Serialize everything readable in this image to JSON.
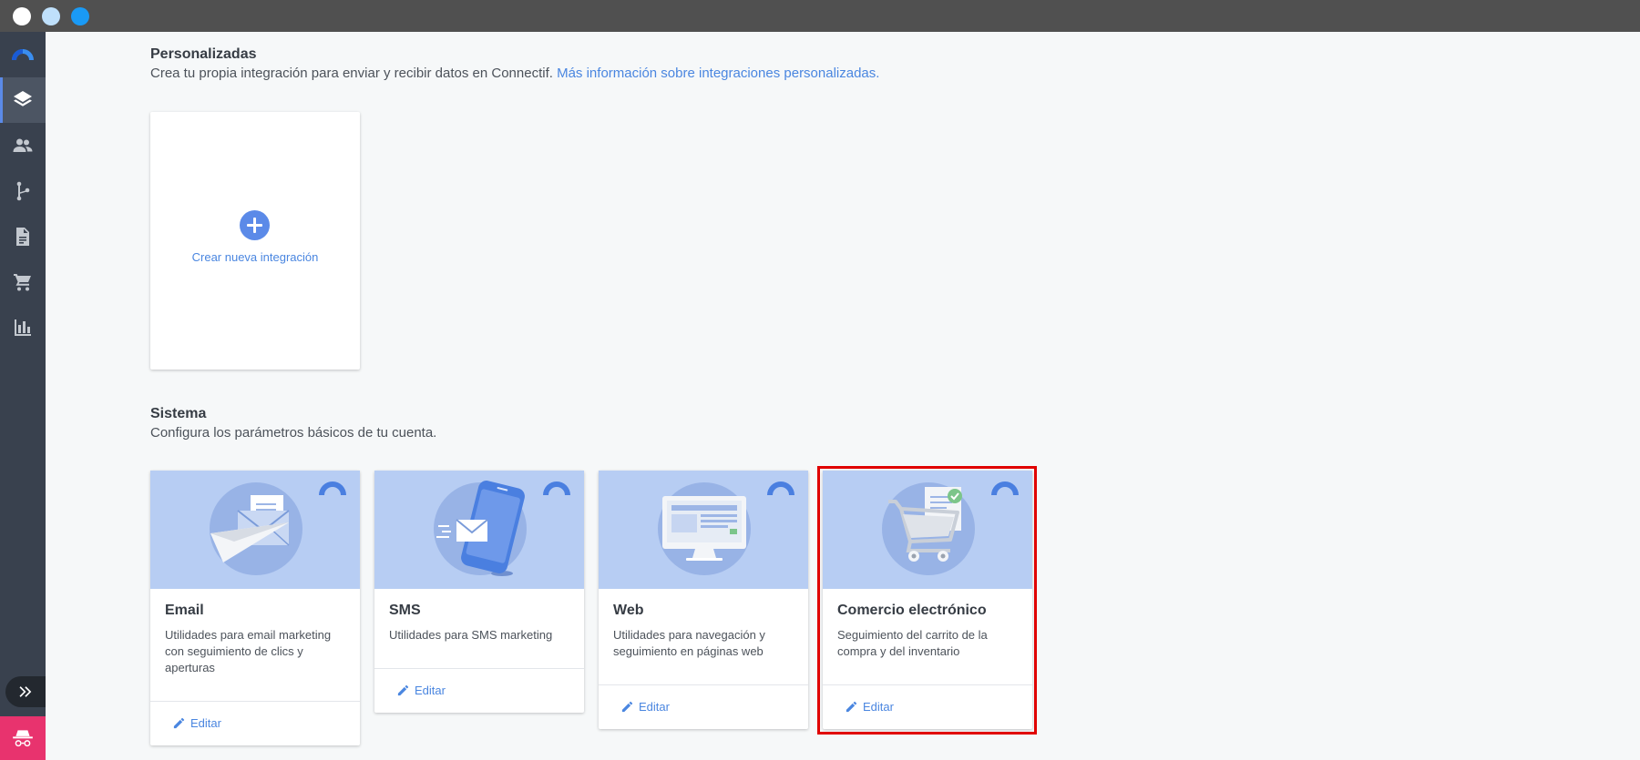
{
  "window": {
    "controls": [
      "close",
      "minimize",
      "maximize"
    ]
  },
  "sidebar": {
    "logo": "connectif-logo",
    "items": [
      {
        "icon": "layers-icon",
        "name": "integrations",
        "active": true
      },
      {
        "icon": "people-icon",
        "name": "contacts",
        "active": false
      },
      {
        "icon": "workflow-icon",
        "name": "workflows",
        "active": false
      },
      {
        "icon": "document-icon",
        "name": "content",
        "active": false
      },
      {
        "icon": "cart-icon",
        "name": "store",
        "active": false
      },
      {
        "icon": "bar-chart-icon",
        "name": "reports",
        "active": false
      }
    ],
    "expand_icon": "double-chevron-right-icon",
    "user_icon": "incognito-user-icon",
    "user_color": "#e8336e"
  },
  "custom_section": {
    "title": "Personalizadas",
    "description": "Crea tu propia integración para enviar y recibir datos en Connectif.",
    "link_text": "Más información sobre integraciones personalizadas.",
    "new_integration_label": "Crear nueva integración"
  },
  "system_section": {
    "title": "Sistema",
    "description": "Configura los parámetros básicos de tu cuenta.",
    "cards": [
      {
        "title": "Email",
        "description": "Utilidades para email marketing con seguimiento de clics y aperturas",
        "action": "Editar",
        "icon": "email-paper-plane-icon"
      },
      {
        "title": "SMS",
        "description": "Utilidades para SMS marketing",
        "action": "Editar",
        "icon": "sms-phone-icon"
      },
      {
        "title": "Web",
        "description": "Utilidades para navegación y seguimiento en páginas web",
        "action": "Editar",
        "icon": "web-monitor-icon"
      },
      {
        "title": "Comercio electrónico",
        "description": "Seguimiento del carrito de la compra y del inventario",
        "action": "Editar",
        "icon": "ecommerce-cart-icon",
        "highlighted": true
      }
    ]
  },
  "colors": {
    "accent": "#4a86e0",
    "sidebar_bg": "#39414e",
    "card_illustration_bg": "#b7cdf3",
    "highlight": "#e00000"
  }
}
